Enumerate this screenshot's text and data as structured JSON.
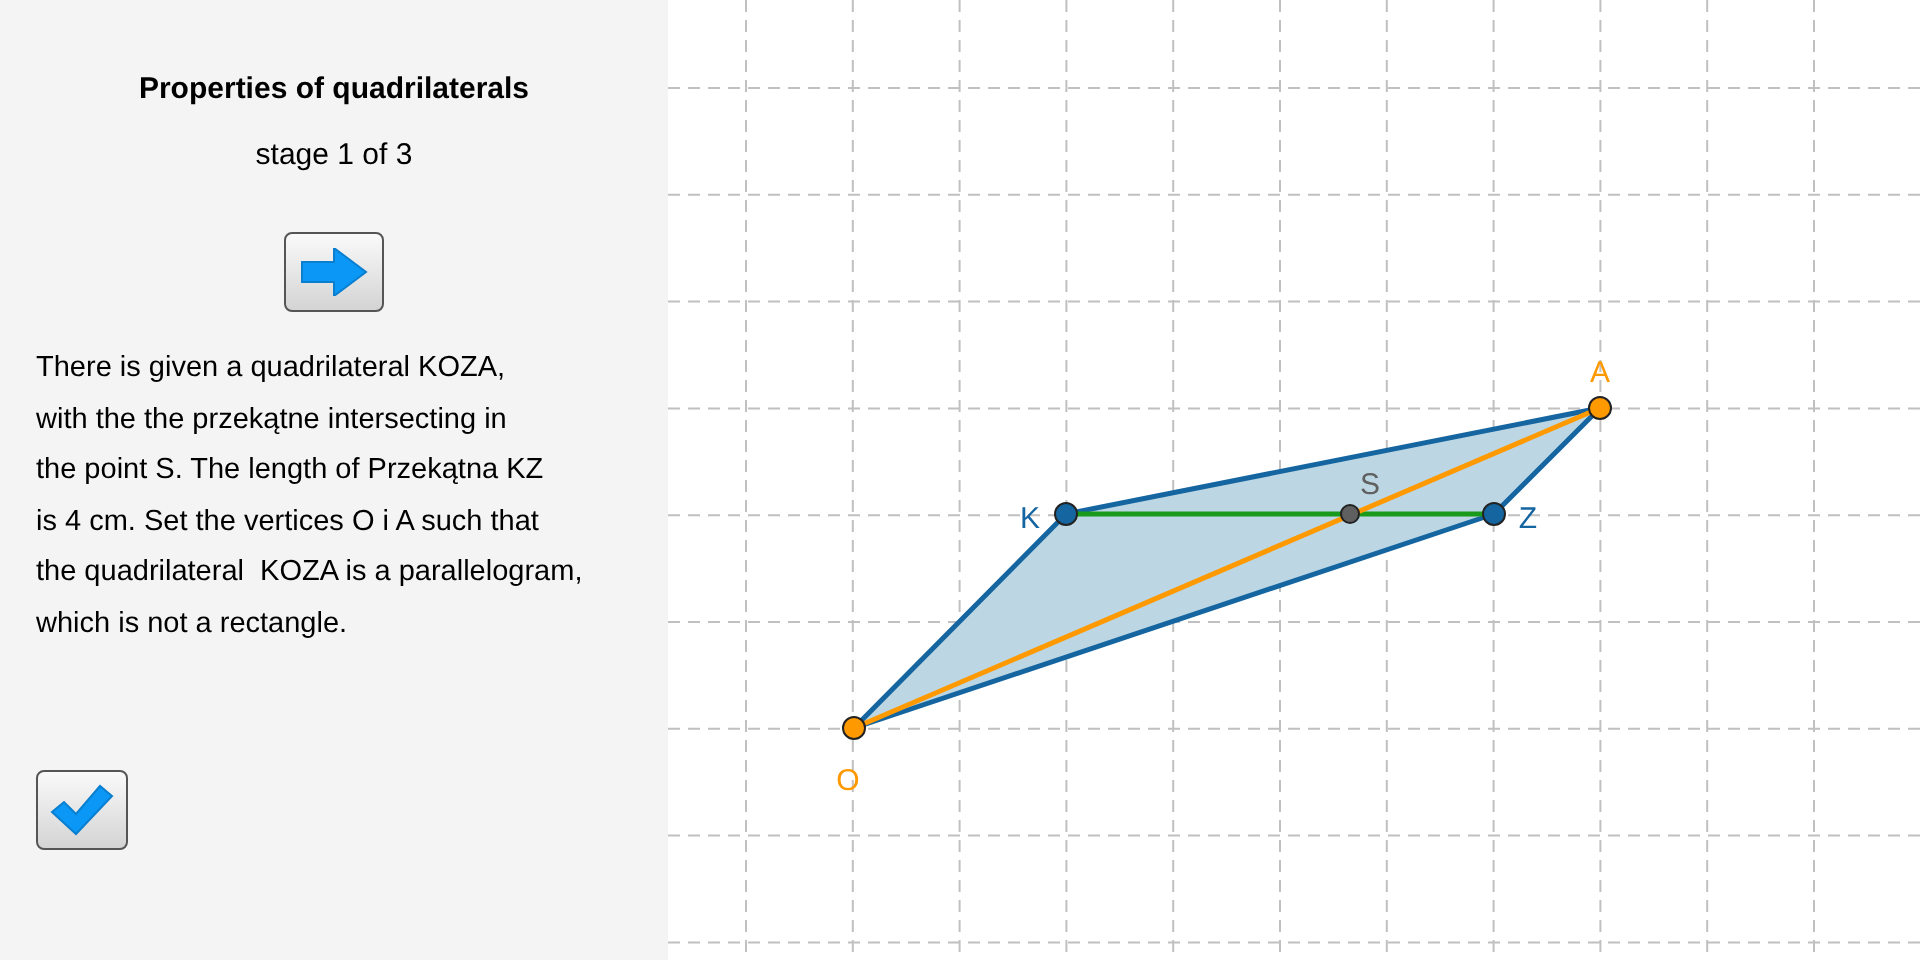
{
  "sidebar": {
    "title": "Properties of quadrilaterals",
    "stage": "stage 1 of 3",
    "description": "There is given a quadrilateral KOZA,\nwith the the przekątne intersecting in\nthe point S. The length of Przekątna KZ\nis 4 cm. Set the vertices O i A such that\nthe quadrilateral  KOZA is a parallelogram,\nwhich is not a rectangle."
  },
  "canvas": {
    "points": [
      {
        "label": "K",
        "color": "#1565a0"
      },
      {
        "label": "O",
        "color": "#ff9900"
      },
      {
        "label": "Z",
        "color": "#1565a0"
      },
      {
        "label": "A",
        "color": "#ff9900"
      },
      {
        "label": "S",
        "color": "#606060"
      }
    ]
  }
}
